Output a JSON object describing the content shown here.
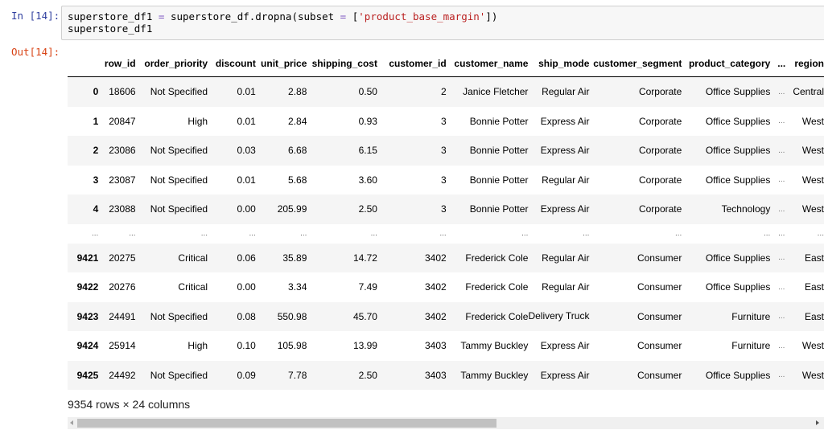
{
  "cell": {
    "in_prompt": "In [14]:",
    "out_prompt": "Out[14]:",
    "code": {
      "line1": {
        "var": "superstore_df1 ",
        "eq": "=",
        "call": " superstore_df.dropna(subset ",
        "eq2": "=",
        "open": " [",
        "string": "'product_base_margin'",
        "close": "])"
      },
      "line2": "superstore_df1"
    }
  },
  "dataframe": {
    "columns": [
      "",
      "row_id",
      "order_priority",
      "discount",
      "unit_price",
      "shipping_cost",
      "customer_id",
      "customer_name",
      "ship_mode",
      "customer_segment",
      "product_category",
      "...",
      "region"
    ],
    "rows": [
      {
        "index": "0",
        "cells": [
          "18606",
          "Not Specified",
          "0.01",
          "2.88",
          "0.50",
          "2",
          "Janice Fletcher",
          "Regular Air",
          "Corporate",
          "Office Supplies",
          "...",
          "Central"
        ]
      },
      {
        "index": "1",
        "cells": [
          "20847",
          "High",
          "0.01",
          "2.84",
          "0.93",
          "3",
          "Bonnie Potter",
          "Express Air",
          "Corporate",
          "Office Supplies",
          "...",
          "West"
        ]
      },
      {
        "index": "2",
        "cells": [
          "23086",
          "Not Specified",
          "0.03",
          "6.68",
          "6.15",
          "3",
          "Bonnie Potter",
          "Express Air",
          "Corporate",
          "Office Supplies",
          "...",
          "West"
        ]
      },
      {
        "index": "3",
        "cells": [
          "23087",
          "Not Specified",
          "0.01",
          "5.68",
          "3.60",
          "3",
          "Bonnie Potter",
          "Regular Air",
          "Corporate",
          "Office Supplies",
          "...",
          "West"
        ]
      },
      {
        "index": "4",
        "cells": [
          "23088",
          "Not Specified",
          "0.00",
          "205.99",
          "2.50",
          "3",
          "Bonnie Potter",
          "Express Air",
          "Corporate",
          "Technology",
          "...",
          "West"
        ]
      },
      {
        "index": "...",
        "cells": [
          "...",
          "...",
          "...",
          "...",
          "...",
          "...",
          "...",
          "...",
          "...",
          "...",
          "...",
          "..."
        ]
      },
      {
        "index": "9421",
        "cells": [
          "20275",
          "Critical",
          "0.06",
          "35.89",
          "14.72",
          "3402",
          "Frederick Cole",
          "Regular Air",
          "Consumer",
          "Office Supplies",
          "...",
          "East"
        ]
      },
      {
        "index": "9422",
        "cells": [
          "20276",
          "Critical",
          "0.00",
          "3.34",
          "7.49",
          "3402",
          "Frederick Cole",
          "Regular Air",
          "Consumer",
          "Office Supplies",
          "...",
          "East"
        ]
      },
      {
        "index": "9423",
        "cells": [
          "24491",
          "Not Specified",
          "0.08",
          "550.98",
          "45.70",
          "3402",
          "Frederick Cole",
          "Delivery Truck",
          "Consumer",
          "Furniture",
          "...",
          "East"
        ]
      },
      {
        "index": "9424",
        "cells": [
          "25914",
          "High",
          "0.10",
          "105.98",
          "13.99",
          "3403",
          "Tammy Buckley",
          "Express Air",
          "Consumer",
          "Furniture",
          "...",
          "West"
        ]
      },
      {
        "index": "9425",
        "cells": [
          "24492",
          "Not Specified",
          "0.09",
          "7.78",
          "2.50",
          "3403",
          "Tammy Buckley",
          "Express Air",
          "Consumer",
          "Office Supplies",
          "...",
          "West"
        ]
      }
    ],
    "shape_text": "9354 rows × 24 columns",
    "scroll_position_fraction": 0
  },
  "icons": {
    "scroll_left": "triangle-left",
    "scroll_right": "triangle-right"
  }
}
